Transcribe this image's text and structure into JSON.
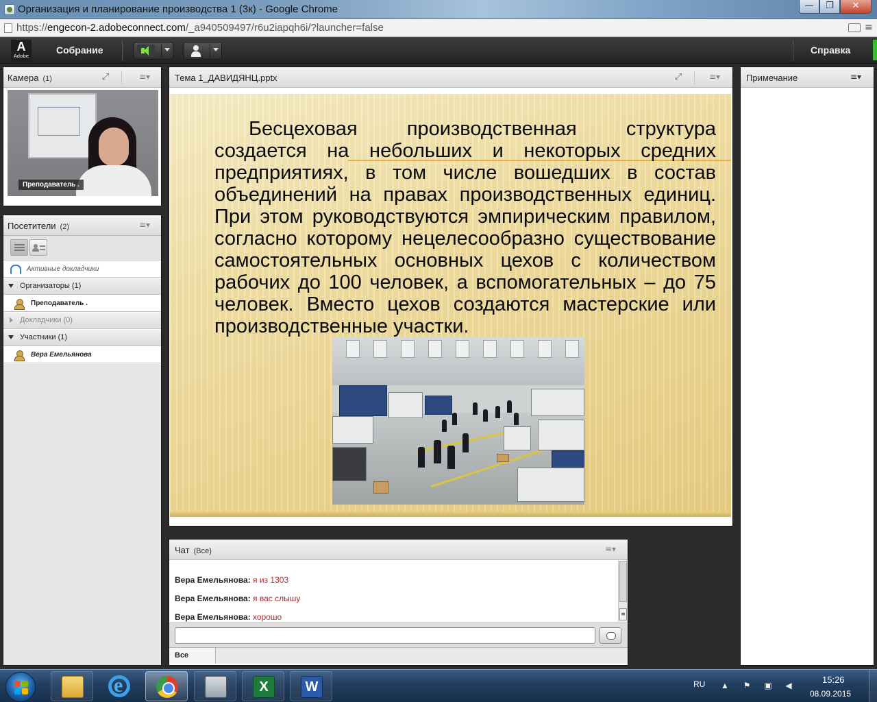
{
  "browser": {
    "window_title": "Организация и планирование производства 1 (3к) - Google Chrome",
    "url_prefix": "https://",
    "url_host": "engecon-2.adobeconnect.com",
    "url_path": "/_a940509497/r6u2iapqh6i/?launcher=false",
    "window_buttons": {
      "minimize": "—",
      "maximize": "❐",
      "close": "✕"
    }
  },
  "connect": {
    "logo_text": "Adobe",
    "meeting_menu": "Собрание",
    "help_menu": "Справка"
  },
  "camera_pod": {
    "title": "Камера",
    "count": "(1)",
    "caption": "Преподаватель ."
  },
  "attendees_pod": {
    "title": "Посетители",
    "count": "(2)",
    "active_speakers": "Активные докладчики",
    "hosts": "Организаторы (1)",
    "host_name": "Преподаватель .",
    "presenters": "Докладчики (0)",
    "participants": "Участники (1)",
    "participant_name": "Вера Емельянова"
  },
  "share_pod": {
    "title": "Тема 1_ДАВИДЯНЦ.pptx",
    "slide_text": "Бесцеховая производственная структура создается на небольших и некоторых средних предприятиях, в том числе вошедших в состав объединений на правах производственных единиц. При этом руководствуются эмпирическим правилом, согласно которому нецелесообразно существование самостоятельных основных цехов с количеством рабочих до 100 человек, а вспомогательных – до 75 человек. Вместо цехов создаются мастерские или производственные участки."
  },
  "chat_pod": {
    "title": "Чат",
    "scope": "(Все)",
    "messages": [
      {
        "sender": "Вера Емельянова:",
        "text": "я из 1303"
      },
      {
        "sender": "Вера Емельянова:",
        "text": "я вас слышу"
      },
      {
        "sender": "Вера Емельянова:",
        "text": "хорошо"
      }
    ],
    "input_value": "",
    "tab_all": "Все"
  },
  "notes_pod": {
    "title": "Примечание"
  },
  "taskbar": {
    "language": "RU",
    "time": "15:26",
    "date": "08.09.2015"
  },
  "colors": {
    "chat_message": "#b12a2a",
    "speaker_active": "#7fe04a",
    "slide_background": "#f1dfa3"
  }
}
